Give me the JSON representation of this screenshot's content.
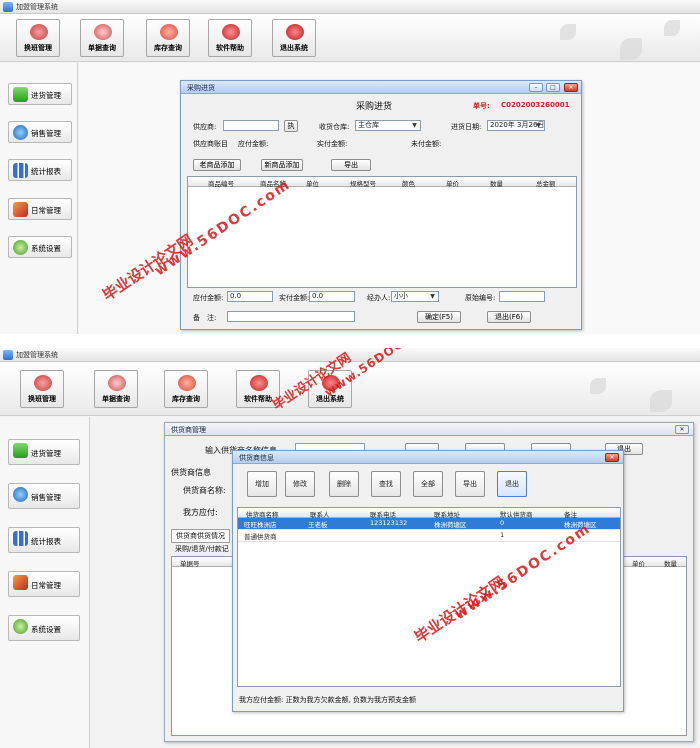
{
  "app": {
    "title": "加盟管理系统"
  },
  "toolbar": {
    "items": [
      {
        "label": "换班管理",
        "icon": "people-icon"
      },
      {
        "label": "单据查询",
        "icon": "magnifier-icon"
      },
      {
        "label": "库存查询",
        "icon": "stack-icon"
      },
      {
        "label": "软件帮助",
        "icon": "help-icon"
      },
      {
        "label": "退出系统",
        "icon": "power-icon"
      }
    ]
  },
  "sidebar": {
    "items": [
      {
        "label": "进货管理",
        "icon": "plus-icon"
      },
      {
        "label": "销售管理",
        "icon": "globe-icon"
      },
      {
        "label": "统计报表",
        "icon": "chart-icon"
      },
      {
        "label": "日常管理",
        "icon": "tools-icon"
      },
      {
        "label": "系统设置",
        "icon": "gear-icon"
      }
    ]
  },
  "purchase": {
    "window_title": "采购进货",
    "heading": "采购进货",
    "order_label": "单号:",
    "order_no": "C0202003260001",
    "supplier_label": "供应商:",
    "supplier_value": "",
    "pick_btn": "执",
    "warehouse_label": "收货仓库:",
    "warehouse_value": "主仓库",
    "date_label": "进货日期:",
    "date_value": "2020年 3月26日",
    "account_label": "供应商账目",
    "payable_amount_label": "应付金额:",
    "paid_amount_label": "实付金额:",
    "unpaid_amount_label": "未付金额:",
    "add_old_btn": "老商品添加",
    "add_new_btn": "新商品添加",
    "export_btn": "导出",
    "columns": [
      "商品编号",
      "商品名称",
      "单位",
      "规格型号",
      "颜色",
      "单价",
      "数量",
      "总金额"
    ],
    "payable_label": "应付金额:",
    "payable_value": "0.0",
    "paid_label": "实付金额:",
    "paid_value": "0.0",
    "handler_label": "经办人:",
    "handler_value": "小小",
    "orig_no_label": "原始编号:",
    "remark_label": "备　注:",
    "ok_btn": "确定(F5)",
    "exit_btn": "退出(F6)"
  },
  "supplier_mgmt": {
    "window_title": "供货商管理",
    "info_label": "供货商信息",
    "input_label": "输入供货商名称信息",
    "name_label": "供货商名称:",
    "payable_label": "我方应付:",
    "tab_label": "供货商供货情况",
    "sub_label": "采购/退货/付款记",
    "col_left": "单据号",
    "col_price": "单价",
    "col_qty": "数量",
    "right_btn": "退出"
  },
  "supplier_info": {
    "window_title": "供货商信息",
    "buttons": [
      "增加",
      "修改",
      "删除",
      "查找",
      "全部",
      "导出",
      "退出"
    ],
    "columns": [
      "供货商名称",
      "联系人",
      "联系电话",
      "联系地址",
      "默认供货商",
      "备注"
    ],
    "rows": [
      [
        "旺旺株洲店",
        "王老板",
        "123123132",
        "株洲荷塘区",
        "0",
        "株洲荷塘区"
      ],
      [
        "普通供货商",
        "",
        "",
        "",
        "1",
        ""
      ]
    ],
    "footer": "我方应付金额: 正数为我方欠款金额, 负数为我方预支金额"
  },
  "watermarks": [
    {
      "text": "毕业设计论文网"
    },
    {
      "text": "www.56DOC.com"
    }
  ],
  "colors": {
    "accent_red": "#d81e1e",
    "title_blue": "#b6cdee",
    "select_blue": "#2f7bd6"
  }
}
